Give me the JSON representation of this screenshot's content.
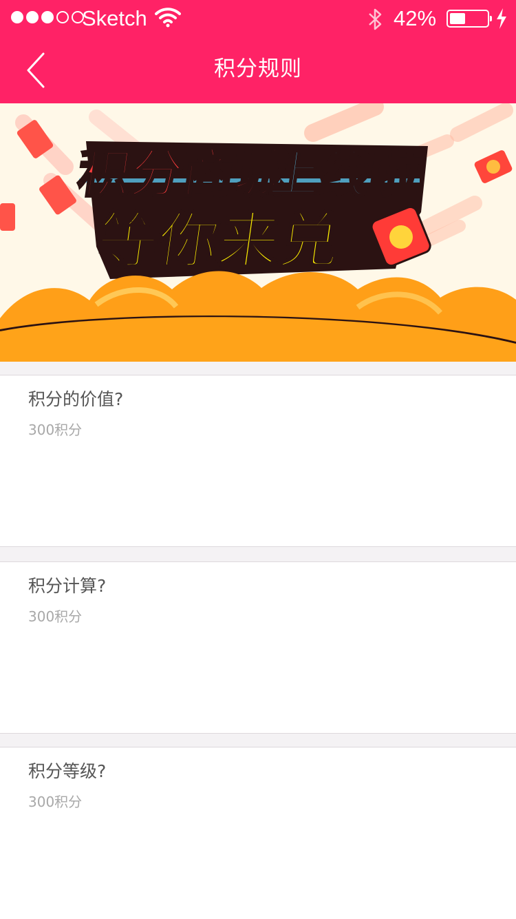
{
  "status_bar": {
    "carrier": "Sketch",
    "battery_percent": "42%",
    "battery_level": 0.42
  },
  "nav": {
    "title": "积分规则"
  },
  "banner": {
    "line1_red": "积分商城",
    "line1_blue": "上线啦",
    "line2": "等你来兑"
  },
  "cards": [
    {
      "question": "积分的价值?",
      "answer": "300积分"
    },
    {
      "question": "积分计算?",
      "answer": "300积分"
    },
    {
      "question": "积分等级?",
      "answer": "300积分"
    }
  ],
  "colors": {
    "primary": "#ff2266",
    "banner_orange": "#ffa419",
    "banner_red": "#ff3d3d",
    "banner_blue": "#59c3ea",
    "banner_yellow": "#fff200"
  }
}
